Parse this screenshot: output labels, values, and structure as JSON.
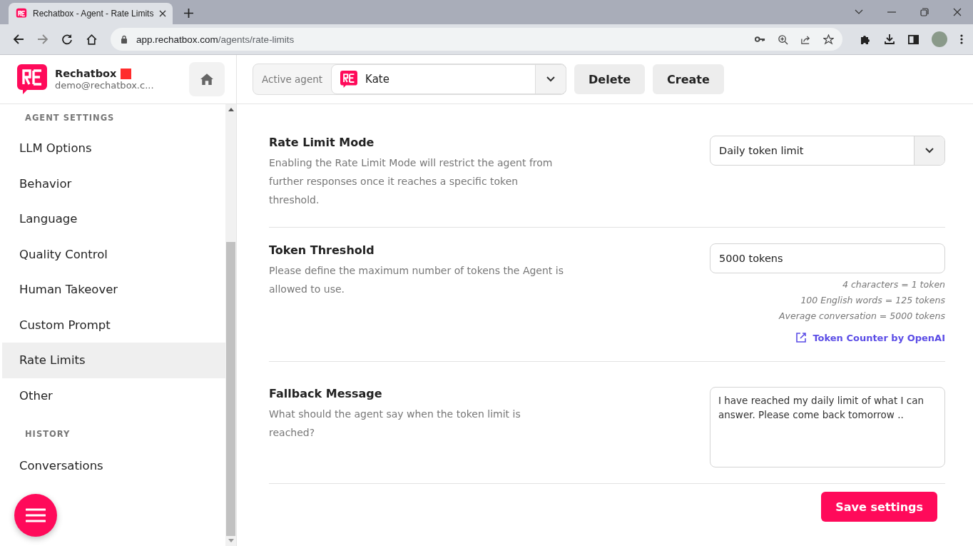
{
  "browser": {
    "tab_title": "Rechatbox - Agent - Rate Limits",
    "url_host": "app.rechatbox.com",
    "url_path": "/agents/rate-limits"
  },
  "account": {
    "name": "Rechatbox",
    "email": "demo@rechatbox.c..."
  },
  "agent_bar": {
    "label": "Active agent",
    "agent": "Kate",
    "buttons": [
      "Delete",
      "Create"
    ]
  },
  "sidebar": {
    "sections": [
      {
        "title": "AGENT SETTINGS",
        "items": [
          {
            "label": "LLM Options",
            "selected": false
          },
          {
            "label": "Behavior",
            "selected": false
          },
          {
            "label": "Language",
            "selected": false
          },
          {
            "label": "Quality Control",
            "selected": false
          },
          {
            "label": "Human Takeover",
            "selected": false
          },
          {
            "label": "Custom Prompt",
            "selected": false
          },
          {
            "label": "Rate Limits",
            "selected": true
          },
          {
            "label": "Other",
            "selected": false
          }
        ]
      },
      {
        "title": "HISTORY",
        "items": [
          {
            "label": "Conversations",
            "selected": false
          }
        ]
      }
    ]
  },
  "settings": [
    {
      "kind": "select",
      "title": "Rate Limit Mode",
      "description": "Enabling the Rate Limit Mode will restrict the agent from further responses once it reaches a specific token threshold.",
      "value": "Daily token limit"
    },
    {
      "kind": "input",
      "title": "Token Threshold",
      "description": "Please define the maximum number of tokens the Agent is allowed to use.",
      "value": "5000 tokens",
      "hints": [
        "4 characters = 1 token",
        "100 English words = 125 tokens",
        "Average conversation = 5000 tokens"
      ],
      "link": "Token Counter by OpenAI"
    },
    {
      "kind": "textarea",
      "title": "Fallback Message",
      "description": "What should the agent say when the token limit is reached?",
      "value": "I have reached my daily limit of what I can answer. Please come back tomorrow .."
    }
  ],
  "save_button": "Save settings"
}
